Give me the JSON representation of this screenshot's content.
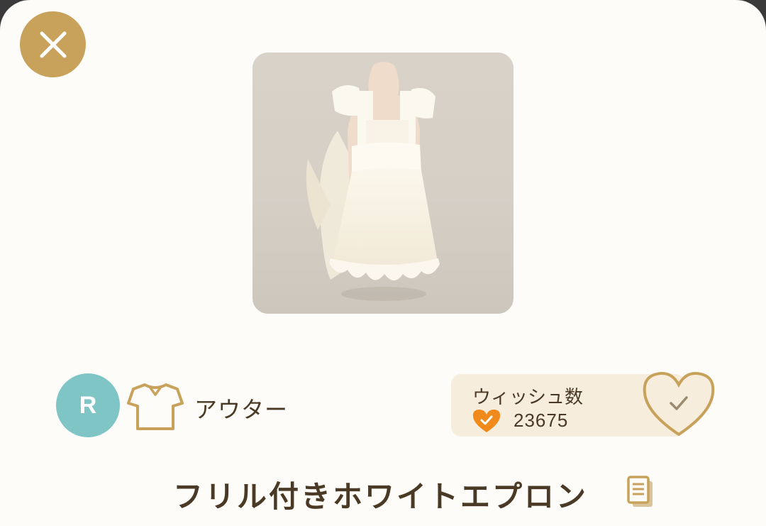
{
  "colors": {
    "accent_gold": "#c8a25a",
    "rarity_teal": "#7fc5c6",
    "text_brown": "#4a3a25",
    "wish_orange": "#f08a1a",
    "panel_cream": "#f6eddd"
  },
  "header": {
    "close_icon": "close-icon"
  },
  "item": {
    "image_alt": "white frilled apron dress",
    "rarity": "R",
    "category_icon": "shirt-icon",
    "category": "アウター",
    "name": "フリル付きホワイトエプロン"
  },
  "wish": {
    "title": "ウィッシュ数",
    "count": "23675",
    "button_icon": "heart-check-icon"
  },
  "actions": {
    "copy_icon": "copy-icon"
  }
}
